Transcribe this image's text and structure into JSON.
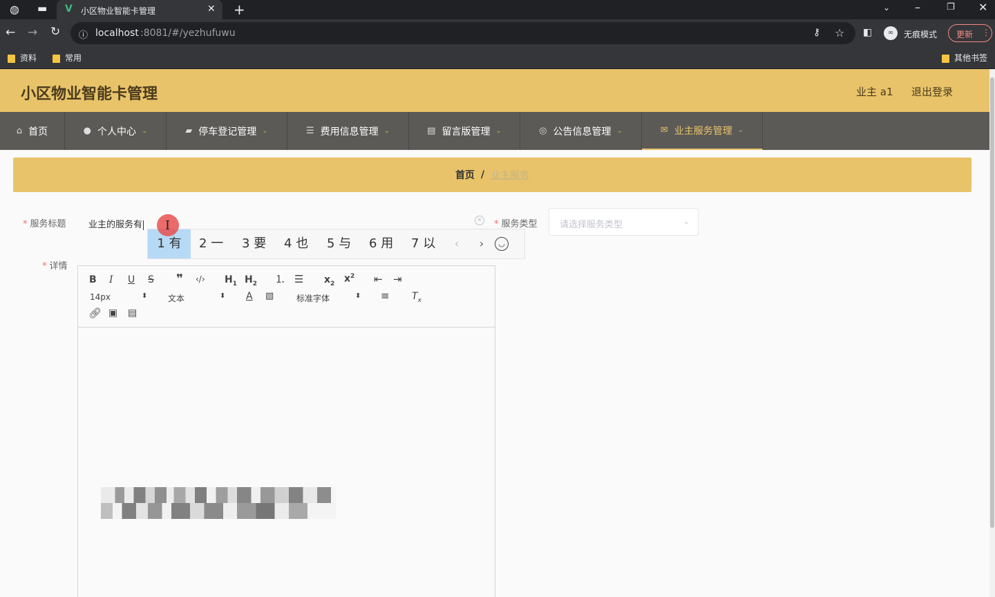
{
  "browser": {
    "tab_title": "小区物业智能卡管理",
    "url_host": "localhost",
    "url_rest": ":8081/#/yezhufuwu",
    "incognito_label": "无痕模式",
    "update_label": "更新",
    "bookmarks": [
      {
        "label": "资料"
      },
      {
        "label": "常用"
      }
    ],
    "other_bookmarks": "其他书签"
  },
  "app": {
    "title": "小区物业智能卡管理",
    "user": "业主 a1",
    "logout": "退出登录"
  },
  "nav": [
    {
      "label": "首页",
      "icon": "home-icon",
      "has_dropdown": false,
      "active": false
    },
    {
      "label": "个人中心",
      "icon": "user-icon",
      "has_dropdown": true,
      "active": false
    },
    {
      "label": "停车登记管理",
      "icon": "briefcase-icon",
      "has_dropdown": true,
      "active": false
    },
    {
      "label": "费用信息管理",
      "icon": "list-icon",
      "has_dropdown": true,
      "active": false
    },
    {
      "label": "留言版管理",
      "icon": "document-icon",
      "has_dropdown": true,
      "active": false
    },
    {
      "label": "公告信息管理",
      "icon": "settings-icon",
      "has_dropdown": true,
      "active": false
    },
    {
      "label": "业主服务管理",
      "icon": "mail-icon",
      "has_dropdown": true,
      "active": true
    }
  ],
  "breadcrumb": {
    "home": "首页",
    "separator": "/",
    "current": "业主服务"
  },
  "form": {
    "title_label": "服务标题",
    "title_value": "业主的服务有",
    "type_label": "服务类型",
    "type_placeholder": "请选择服务类型",
    "detail_label": "详情"
  },
  "ime": {
    "candidates": [
      {
        "num": "1",
        "char": "有"
      },
      {
        "num": "2",
        "char": "一"
      },
      {
        "num": "3",
        "char": "要"
      },
      {
        "num": "4",
        "char": "也"
      },
      {
        "num": "5",
        "char": "与"
      },
      {
        "num": "6",
        "char": "用"
      },
      {
        "num": "7",
        "char": "以"
      }
    ],
    "selected_index": 0
  },
  "editor": {
    "font_size": "14px",
    "header_select": "文本",
    "font_family": "标准字体",
    "buttons": [
      "bold",
      "italic",
      "underline",
      "strike",
      "blockquote",
      "code-block",
      "h1",
      "h2",
      "ordered-list",
      "bullet-list",
      "subscript",
      "superscript",
      "outdent",
      "indent",
      "color",
      "background",
      "align",
      "clean",
      "link",
      "image",
      "video"
    ]
  },
  "colors": {
    "brand": "#e8c369",
    "nav_bg": "#5c5a57",
    "required": "#f56c6c"
  }
}
